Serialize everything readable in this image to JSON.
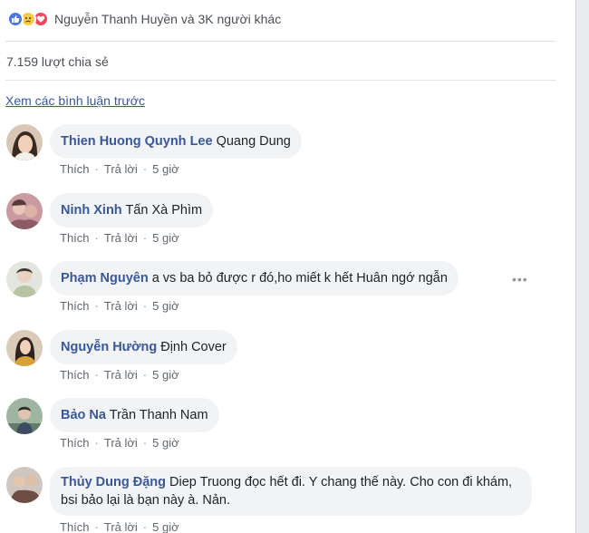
{
  "reactions": {
    "icons": [
      "like-icon",
      "sad-icon",
      "love-icon"
    ],
    "summary": "Nguyễn Thanh Huyền và 3K người khác"
  },
  "shares": "7.159 lượt chia sẻ",
  "previous_comments_link": "Xem các bình luận trước",
  "comments": [
    {
      "author": "Thien Huong Quynh Lee",
      "text": "Quang Dung",
      "actions": [
        "Thích",
        "Trả lời",
        "5 giờ"
      ]
    },
    {
      "author": "Ninh Xinh",
      "text": "Tấn Xà Phìm",
      "actions": [
        "Thích",
        "Trả lời",
        "5 giờ"
      ]
    },
    {
      "author": "Phạm Nguyên",
      "text": "a vs ba bỏ được r đó,ho miết k hết Huân ngớ ngẫn",
      "actions": [
        "Thích",
        "Trả lời",
        "5 giờ"
      ],
      "more": "•••"
    },
    {
      "author": "Nguyễn Hường",
      "text": "Định Cover",
      "actions": [
        "Thích",
        "Trả lời",
        "5 giờ"
      ]
    },
    {
      "author": "Bảo Na",
      "text": "Trần Thanh Nam",
      "actions": [
        "Thích",
        "Trả lời",
        "5 giờ"
      ]
    },
    {
      "author": "Thủy Dung Đặng",
      "text": "Diep Truong đọc hết đi. Y chang thế này. Cho con đi khám, bsi bảo lại là bạn này à. Nản.",
      "actions": [
        "Thích",
        "Trả lời",
        "5 giờ"
      ]
    }
  ],
  "colors": {
    "author": "#385898",
    "bubble": "#f2f3f5",
    "meta": "#616770",
    "like": "#4a76e8",
    "love": "#f0445b",
    "sad": "#f7c948"
  }
}
